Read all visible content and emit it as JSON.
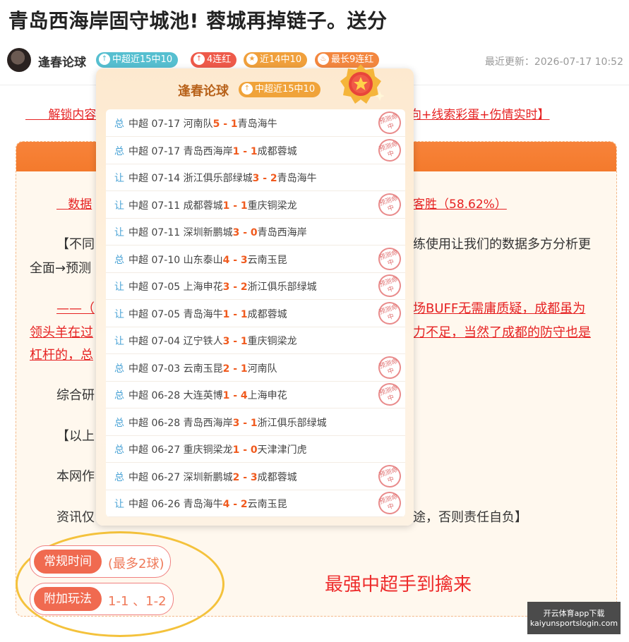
{
  "title": "青岛西海岸固守城池! 蓉城再掉链子。送分",
  "author": {
    "name": "逢春论球",
    "badges": [
      {
        "label": "中超近15中10",
        "icon": "arrow-up-icon"
      },
      {
        "label": "4连红",
        "icon": "arrow-up-icon"
      },
      {
        "label": "近14中10",
        "icon": "star-icon"
      },
      {
        "label": "最长9连红",
        "icon": "fire-icon"
      }
    ],
    "updated": "最近更新：2026-07-17 10:52"
  },
  "article": {
    "unlock_left": "解锁内容",
    "unlock_right": "向+线索彩蛋+伤情实时】",
    "data_left": "数据",
    "data_right": "客胜（58.62%）",
    "p1_left": "【不同",
    "p1_right": "练使用让我们的数据多方分析更",
    "p1_line2": "全面→预测",
    "red1_left": "——（",
    "red1_right": "场BUFF无需庸质疑，成都虽为",
    "red2_left": "领头羊在过",
    "red2_right": "力不足，当然了成都的防守也是",
    "red3_left": "杠杆的，总",
    "p2": "综合研",
    "p3": "【以上",
    "p4": "本网作",
    "p5_left": "资讯仅",
    "p5_right": "途，否则责任自负】"
  },
  "plays": [
    {
      "label": "常规时间",
      "value": "(最多2球)"
    },
    {
      "label": "附加玩法",
      "value": "1-1 、1-2"
    }
  ],
  "promo": "最强中超手到擒来",
  "watermark": {
    "line1": "开云体育app下载",
    "line2": "kaiyunsportslogin.com"
  },
  "popover": {
    "name": "逢春论球",
    "badge": "中超近15中10",
    "stamp_text": "预测命中",
    "records": [
      {
        "type": "总",
        "league": "中超",
        "date": "07-17",
        "home": "河南队",
        "hs": "5",
        "as": "1",
        "away": "青岛海牛",
        "hit": true
      },
      {
        "type": "总",
        "league": "中超",
        "date": "07-17",
        "home": "青岛西海岸",
        "hs": "1",
        "as": "1",
        "away": "成都蓉城",
        "hit": true
      },
      {
        "type": "让",
        "league": "中超",
        "date": "07-14",
        "home": "浙江俱乐部绿城",
        "hs": "3",
        "as": "2",
        "away": "青岛海牛",
        "hit": false
      },
      {
        "type": "让",
        "league": "中超",
        "date": "07-11",
        "home": "成都蓉城",
        "hs": "1",
        "as": "1",
        "away": "重庆铜梁龙",
        "hit": true
      },
      {
        "type": "让",
        "league": "中超",
        "date": "07-11",
        "home": "深圳新鹏城",
        "hs": "3",
        "as": "0",
        "away": "青岛西海岸",
        "hit": false
      },
      {
        "type": "总",
        "league": "中超",
        "date": "07-10",
        "home": "山东泰山",
        "hs": "4",
        "as": "3",
        "away": "云南玉昆",
        "hit": true
      },
      {
        "type": "让",
        "league": "中超",
        "date": "07-05",
        "home": "上海申花",
        "hs": "3",
        "as": "2",
        "away": "浙江俱乐部绿城",
        "hit": true
      },
      {
        "type": "让",
        "league": "中超",
        "date": "07-05",
        "home": "青岛海牛",
        "hs": "1",
        "as": "1",
        "away": "成都蓉城",
        "hit": true
      },
      {
        "type": "让",
        "league": "中超",
        "date": "07-04",
        "home": "辽宁铁人",
        "hs": "3",
        "as": "1",
        "away": "重庆铜梁龙",
        "hit": false
      },
      {
        "type": "总",
        "league": "中超",
        "date": "07-03",
        "home": "云南玉昆",
        "hs": "2",
        "as": "1",
        "away": "河南队",
        "hit": true
      },
      {
        "type": "总",
        "league": "中超",
        "date": "06-28",
        "home": "大连英博",
        "hs": "1",
        "as": "4",
        "away": "上海申花",
        "hit": true
      },
      {
        "type": "总",
        "league": "中超",
        "date": "06-28",
        "home": "青岛西海岸",
        "hs": "3",
        "as": "1",
        "away": "浙江俱乐部绿城",
        "hit": false
      },
      {
        "type": "总",
        "league": "中超",
        "date": "06-27",
        "home": "重庆铜梁龙",
        "hs": "1",
        "as": "0",
        "away": "天津津门虎",
        "hit": false
      },
      {
        "type": "总",
        "league": "中超",
        "date": "06-27",
        "home": "深圳新鹏城",
        "hs": "2",
        "as": "3",
        "away": "成都蓉城",
        "hit": true
      },
      {
        "type": "让",
        "league": "中超",
        "date": "06-26",
        "home": "青岛海牛",
        "hs": "4",
        "as": "2",
        "away": "云南玉昆",
        "hit": true
      }
    ]
  }
}
